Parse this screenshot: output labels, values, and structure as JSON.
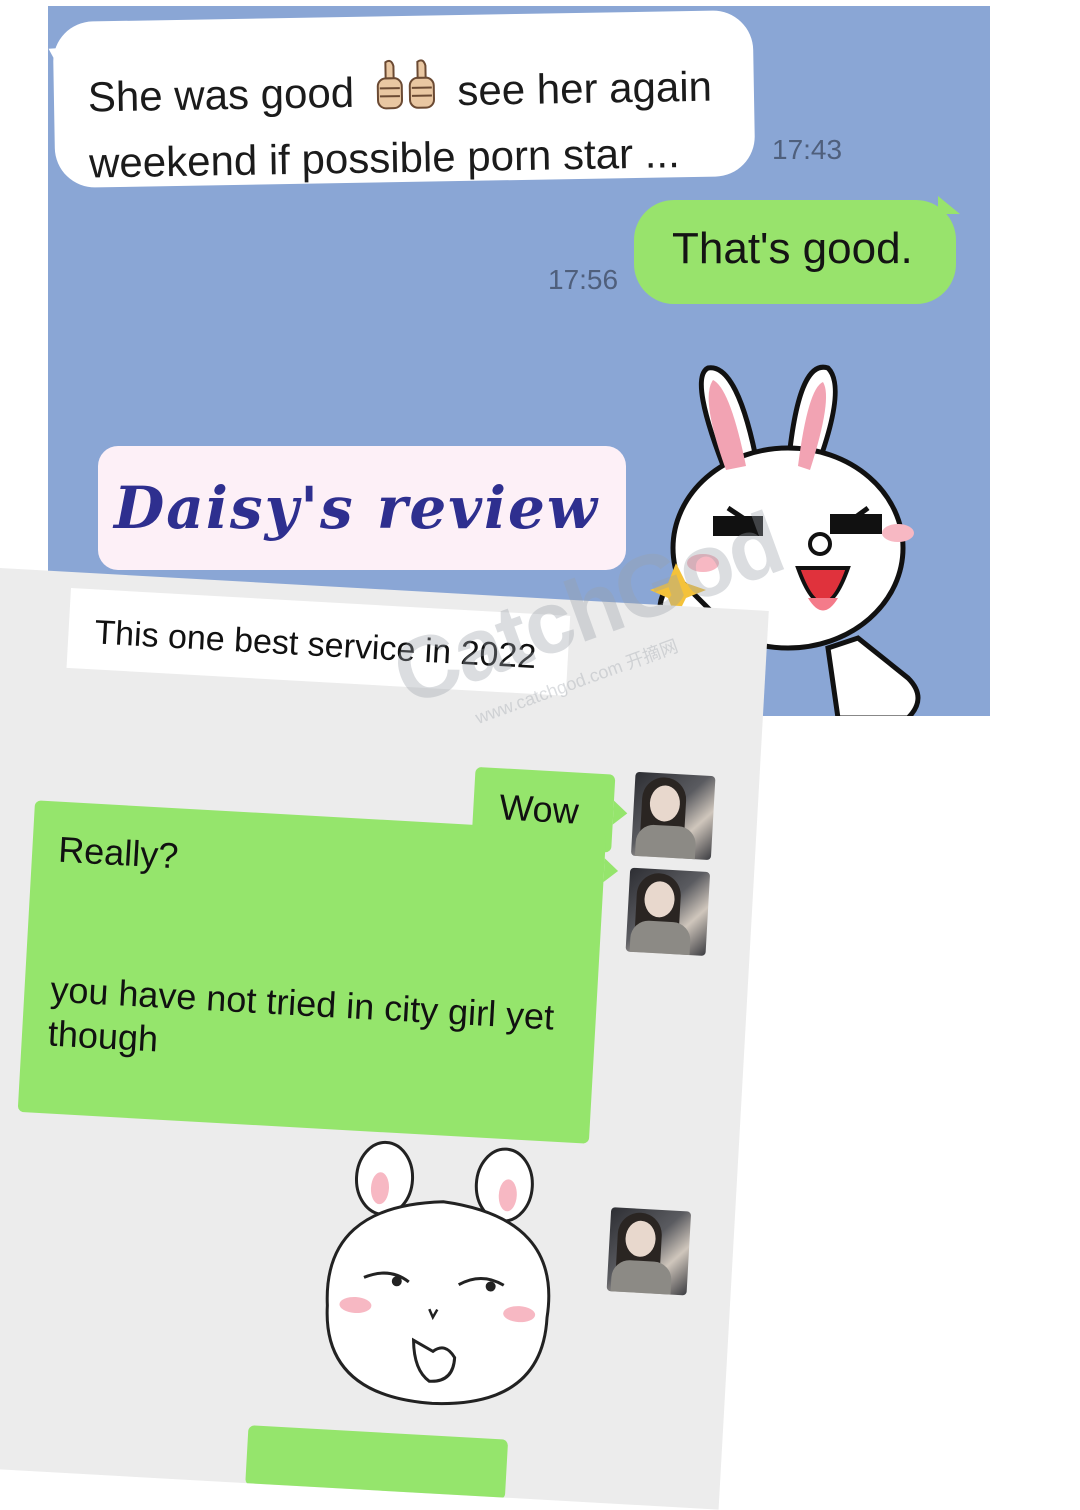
{
  "top_chat": {
    "incoming_message": {
      "line1_before": "She was good",
      "line1_after": "see her again",
      "line2": "weekend if possible  porn star ...",
      "time": "17:43"
    },
    "outgoing_message": {
      "text": "That's good.",
      "time": "17:56"
    },
    "overlay_caption": "Daisy's review"
  },
  "bottom_chat": {
    "notice_text": "This one best service in 2022",
    "messages": [
      {
        "text": "Wow"
      },
      {
        "line1": "Really?",
        "line2": "you have not tried in city girl yet though"
      }
    ]
  },
  "watermark": {
    "main": "CatchGod",
    "sub": "www.catchgod.com 开摘网"
  },
  "colors": {
    "top_background": "#8aa6d5",
    "outgoing_bubble": "#98e36c",
    "bottom_background": "#ececec",
    "bottom_bubble": "#95e56c",
    "caption_text": "#2e2f8f"
  },
  "icons": [
    "thumbs-up-icon",
    "rabbit-sticker",
    "avatar-photo"
  ]
}
